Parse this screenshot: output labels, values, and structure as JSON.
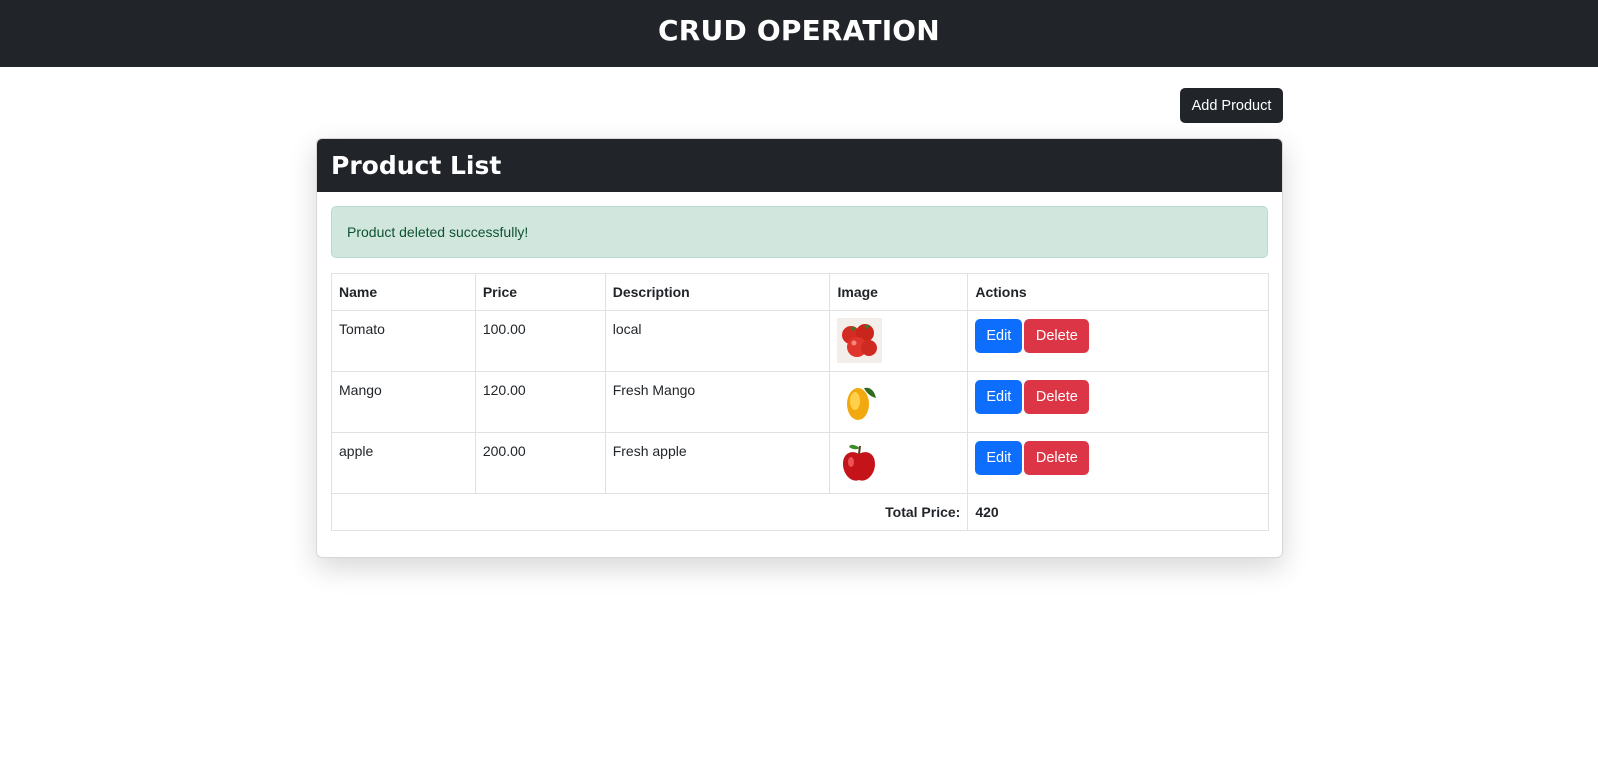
{
  "header": {
    "title": "CRUD OPERATION"
  },
  "toolbar": {
    "add_label": "Add Product"
  },
  "card": {
    "title": "Product List",
    "alert": "Product deleted successfully!"
  },
  "table": {
    "headers": {
      "name": "Name",
      "price": "Price",
      "description": "Description",
      "image": "Image",
      "actions": "Actions"
    },
    "rows": [
      {
        "name": "Tomato",
        "price": "100.00",
        "description": "local",
        "image": "tomato",
        "edit": "Edit",
        "delete": "Delete"
      },
      {
        "name": "Mango",
        "price": "120.00",
        "description": "Fresh Mango",
        "image": "mango",
        "edit": "Edit",
        "delete": "Delete"
      },
      {
        "name": "apple",
        "price": "200.00",
        "description": "Fresh apple",
        "image": "apple",
        "edit": "Edit",
        "delete": "Delete"
      }
    ],
    "footer": {
      "label": "Total Price:",
      "value": "420"
    }
  },
  "colors": {
    "dark": "#212529",
    "primary": "#0d6efd",
    "danger": "#dc3545",
    "success_bg": "#d1e7dd",
    "success_text": "#0f5132"
  }
}
